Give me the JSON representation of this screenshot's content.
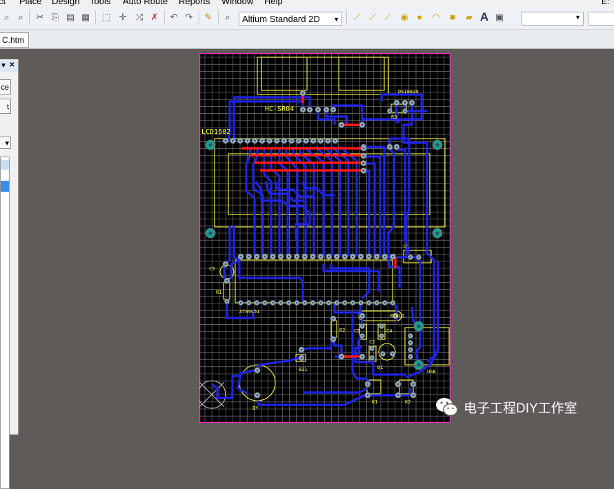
{
  "menus": [
    "ct",
    "Place",
    "Design",
    "Tools",
    "Auto Route",
    "Reports",
    "Window",
    "Help"
  ],
  "path_label": "E:",
  "toolbar": {
    "view_mode": "Altium Standard 2D"
  },
  "document_tab": "C.htm",
  "panel": {
    "button1": "ce",
    "button2": "t"
  },
  "pcb": {
    "labels": {
      "hc": "HC-SR04",
      "ds": "DS18B20",
      "r3": "R3",
      "lcd": "LCD1602",
      "c3": "C3",
      "r1": "R1",
      "mcu": "AT89C51",
      "xtal": "XTAL1",
      "r2": "R2",
      "c5": "C5",
      "c4": "C4",
      "c2": "C2",
      "q1": "Q1",
      "bz1": "BZ1",
      "usb": "USB",
      "by": "BY",
      "k1": "K1",
      "k2": "K2",
      "u": "U"
    }
  },
  "watermark": "电子工程DIY工作室",
  "colors": {
    "board_bg": "#000000",
    "grid": "#8a8a8a",
    "bottom_trace": "#1f23e6",
    "top_trace": "#ff1a1a",
    "silkscreen": "#ffff40",
    "pad": "#9aaec0",
    "outline": "#ff2ad0"
  }
}
